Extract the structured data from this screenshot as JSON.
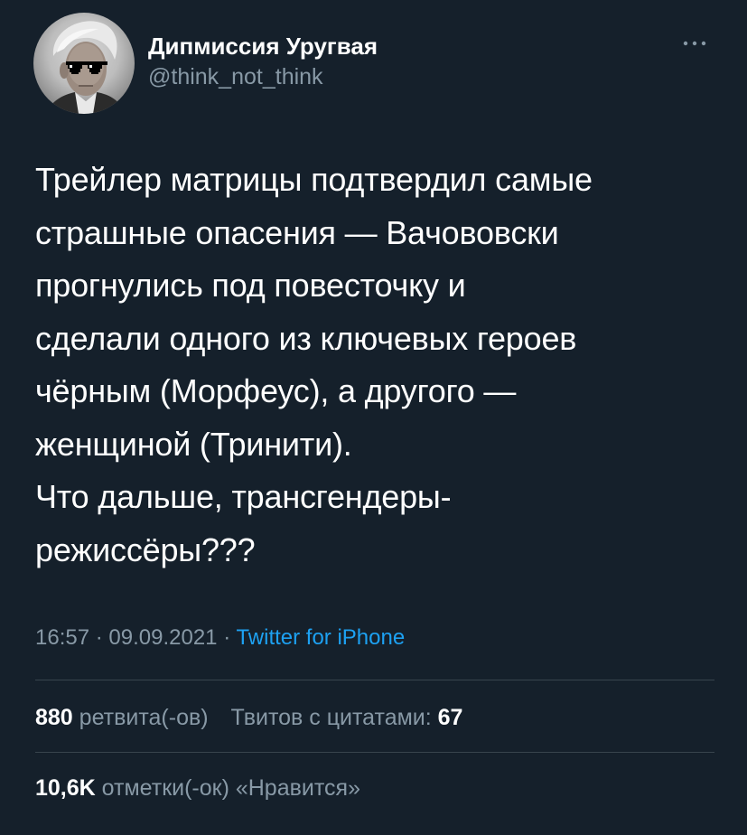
{
  "author": {
    "display_name": "Дипмиссия Уругвая",
    "handle": "@think_not_think"
  },
  "icons": {
    "more": "more-horizontal-icon",
    "avatar": "avatar-portrait-with-pixel-sunglasses"
  },
  "tweet": {
    "lines": [
      "Трейлер матрицы подтвердил самые",
      "страшные опасения — Вачововски",
      "прогнулись под повесточку и",
      "сделали одного из ключевых героев",
      "чёрным (Морфеус), а другого —",
      "женщиной (Тринити).",
      "Что дальше, трансгендеры-",
      "режиссёры???"
    ],
    "time": "16:57",
    "separator": "·",
    "date": "09.09.2021",
    "source": "Twitter for iPhone"
  },
  "stats": {
    "retweets_count": "880",
    "retweets_label": "ретвита(-ов)",
    "quotes_label": "Твитов с цитатами:",
    "quotes_count": "67",
    "likes_count": "10,6K",
    "likes_label": "отметки(-ок) «Нравится»"
  },
  "colors": {
    "background": "#15202b",
    "text_primary": "#ffffff",
    "text_secondary": "#8899a6",
    "link": "#1da1f2",
    "divider": "#38444d"
  }
}
